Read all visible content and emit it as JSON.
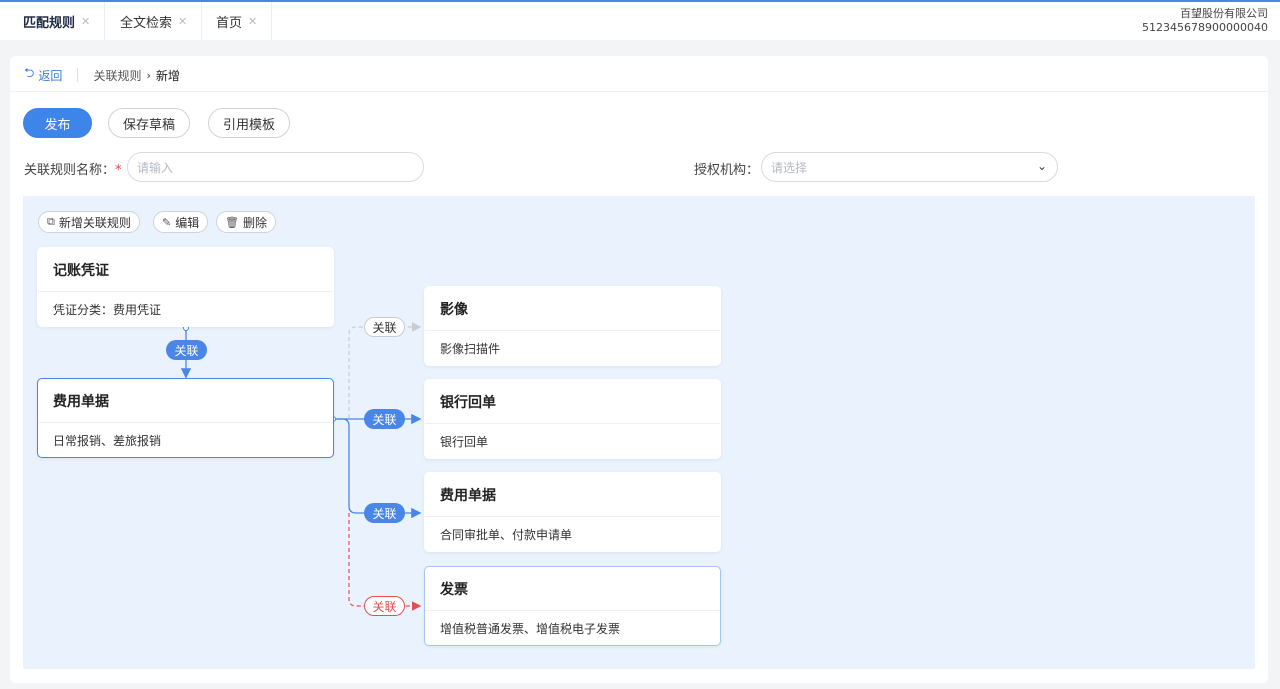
{
  "tabs": [
    {
      "label": "匹配规则",
      "active": true
    },
    {
      "label": "全文检索",
      "active": false
    },
    {
      "label": "首页",
      "active": false
    }
  ],
  "company": {
    "name": "百望股份有限公司",
    "tax_id": "512345678900000040"
  },
  "breadcrumb": {
    "back": "返回",
    "parent": "关联规则",
    "current": "新增"
  },
  "actions": {
    "publish": "发布",
    "save_draft": "保存草稿",
    "use_template": "引用模板"
  },
  "form": {
    "rule_name_label": "关联规则名称：",
    "rule_name_required": "*",
    "rule_name_placeholder": "请输入",
    "org_label": "授权机构：",
    "org_placeholder": "请选择"
  },
  "toolbar": {
    "add": "新增关联规则",
    "edit": "编辑",
    "delete": "删除"
  },
  "nodes": {
    "source": {
      "title": "记账凭证",
      "desc": "凭证分类：费用凭证"
    },
    "main": {
      "title": "费用单据",
      "desc": "日常报销、差旅报销"
    },
    "targets": [
      {
        "title": "影像",
        "desc": "影像扫描件"
      },
      {
        "title": "银行回单",
        "desc": "银行回单"
      },
      {
        "title": "费用单据",
        "desc": "合同审批单、付款申请单"
      },
      {
        "title": "发票",
        "desc": "增值税普通发票、增值税电子发票"
      }
    ]
  },
  "links": {
    "label": "关联"
  },
  "colors": {
    "accent": "#3d85e8",
    "danger": "#e05252",
    "canvas": "#e9f2fd"
  },
  "icons": {
    "back": "undo-arrow-icon",
    "add": "add-rule-icon",
    "edit": "pencil-icon",
    "delete": "trash-icon",
    "dropdown": "chevron-down-icon",
    "close": "close-icon"
  }
}
